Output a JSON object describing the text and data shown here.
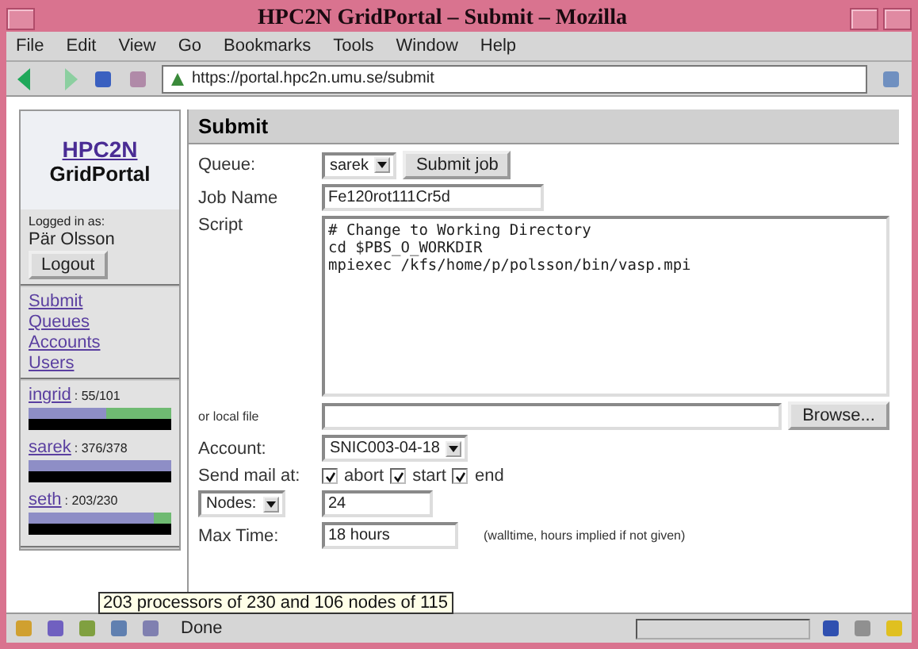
{
  "window": {
    "title": "HPC2N GridPortal – Submit – Mozilla"
  },
  "menu": [
    "File",
    "Edit",
    "View",
    "Go",
    "Bookmarks",
    "Tools",
    "Window",
    "Help"
  ],
  "address": "https://portal.hpc2n.umu.se/submit",
  "sidebar": {
    "logo_title": "HPC2N",
    "logo_subtitle": "GridPortal",
    "logged_in_label": "Logged in as:",
    "user": "Pär Olsson",
    "logout": "Logout",
    "links": [
      "Submit",
      "Queues",
      "Accounts",
      "Users"
    ],
    "clusters": [
      {
        "name": "ingrid",
        "usage": ": 55/101",
        "level": 0.54
      },
      {
        "name": "sarek",
        "usage": ": 376/378",
        "level": 0.995
      },
      {
        "name": "seth",
        "usage": ": 203/230",
        "level": 0.88
      }
    ]
  },
  "form": {
    "heading": "Submit",
    "queue_label": "Queue:",
    "queue": "sarek",
    "submit": "Submit job",
    "jobname_label": "Job Name",
    "jobname": "Fe120rot111Cr5d",
    "script_label": "Script",
    "script": "# Change to Working Directory\ncd $PBS_O_WORKDIR\nmpiexec /kfs/home/p/polsson/bin/vasp.mpi",
    "localfile_label": "or local file",
    "browse": "Browse...",
    "account_label": "Account:",
    "account": "SNIC003-04-18",
    "mail_label": "Send mail at:",
    "mail": [
      {
        "label": "abort",
        "checked": true
      },
      {
        "label": "start",
        "checked": true
      },
      {
        "label": "end",
        "checked": true
      }
    ],
    "nodes_select": "Nodes:",
    "nodes": "24",
    "maxtime_label": "Max Time:",
    "maxtime": "18 hours",
    "maxtime_hint": "(walltime, hours implied if not given)"
  },
  "tooltip": "203 processors of 230 and 106 nodes of 115",
  "status_bar": {
    "text": "Done"
  }
}
